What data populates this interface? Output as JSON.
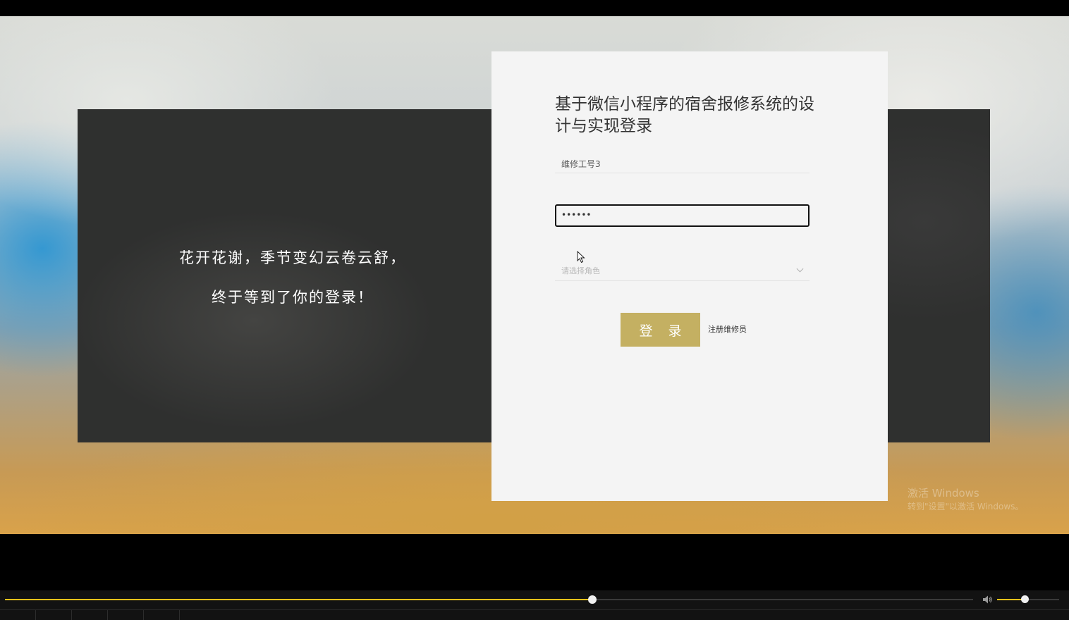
{
  "hero": {
    "slogan_line1": "花开花谢，季节变幻云卷云舒，",
    "slogan_line2": "终于等到了你的登录！"
  },
  "login": {
    "title": "基于微信小程序的宿舍报修系统的设计与实现登录",
    "username_value": "维修工号3",
    "password_value": "••••••",
    "role_placeholder": "请选择角色",
    "login_button": "登 录",
    "register_link": "注册维修员"
  },
  "os_watermark": {
    "line1": "激活 Windows",
    "line2": "转到\"设置\"以激活 Windows。"
  },
  "player": {
    "progress": 0.607,
    "volume": 0.44
  },
  "colors": {
    "accent_gold": "#c4b062",
    "progress_yellow": "#e6c21a",
    "card_bg": "#f4f4f4",
    "panel_dark": "#2f302f"
  },
  "icons": {
    "cursor": "mouse-pointer-icon",
    "volume": "speaker-icon",
    "dropdown": "chevron-down-icon"
  }
}
